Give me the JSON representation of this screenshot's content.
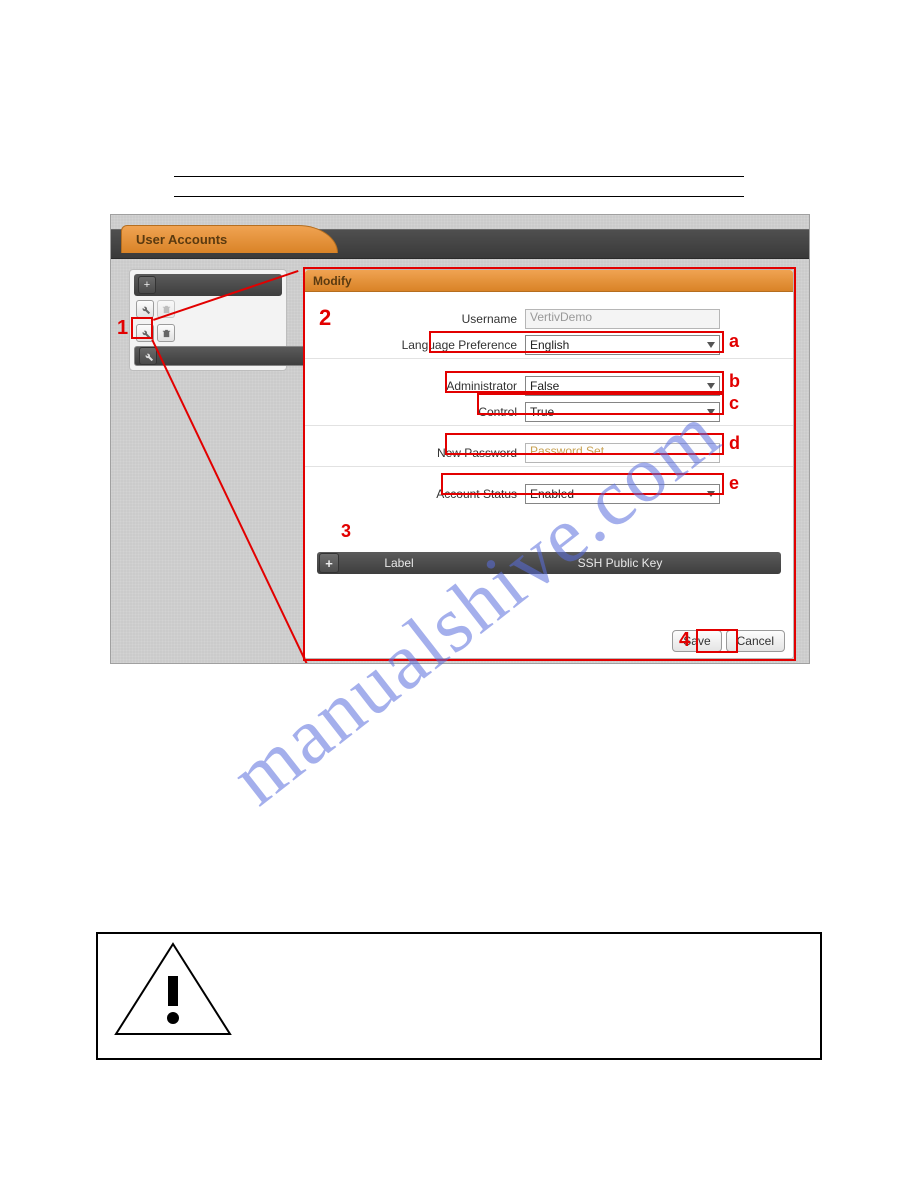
{
  "tab": {
    "title": "User Accounts"
  },
  "modify": {
    "title": "Modify",
    "fields": {
      "username_label": "Username",
      "username_value": "VertivDemo",
      "lang_label": "Language Preference",
      "lang_value": "English",
      "admin_label": "Administrator",
      "admin_value": "False",
      "control_label": "Control",
      "control_value": "True",
      "newpass_label": "New Password",
      "newpass_placeholder": "Password Set...",
      "status_label": "Account Status",
      "status_value": "Enabled"
    },
    "ssh": {
      "col1": "Label",
      "col2": "SSH Public Key"
    },
    "buttons": {
      "save": "Save",
      "cancel": "Cancel"
    }
  },
  "callouts": {
    "n1": "1",
    "n2": "2",
    "n3": "3",
    "n4": "4",
    "a": "a",
    "b": "b",
    "c": "c",
    "d": "d",
    "e": "e"
  },
  "watermark": "manualshive.com"
}
